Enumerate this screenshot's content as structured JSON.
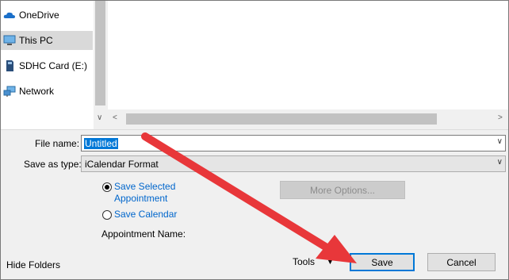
{
  "nav": {
    "items": [
      {
        "label": "OneDrive",
        "icon": "cloud-icon"
      },
      {
        "label": "This PC",
        "icon": "computer-icon",
        "selected": true
      },
      {
        "label": "SDHC Card (E:)",
        "icon": "sd-card-icon"
      },
      {
        "label": "Network",
        "icon": "network-icon"
      }
    ]
  },
  "form": {
    "file_name_label": "File name:",
    "file_name_value": "Untitled",
    "save_as_type_label": "Save as type:",
    "save_as_type_value": "iCalendar Format",
    "radio_save_selected": "Save Selected Appointment",
    "radio_save_selected_checked": true,
    "radio_save_calendar": "Save Calendar",
    "radio_save_calendar_checked": false,
    "more_options_label": "More Options...",
    "appointment_name_label": "Appointment Name:"
  },
  "footer": {
    "hide_folders_label": "Hide Folders",
    "tools_label": "Tools",
    "save_label": "Save",
    "cancel_label": "Cancel"
  },
  "annotation": {
    "arrow_color": "#e8373a"
  },
  "colors": {
    "selection": "#0078d7",
    "link": "#0066cc"
  }
}
